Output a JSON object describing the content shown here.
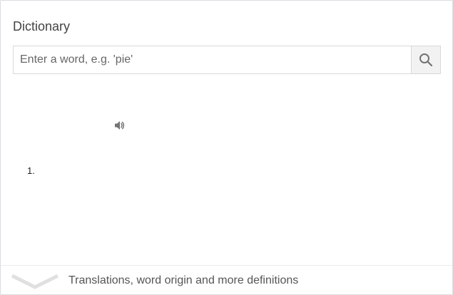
{
  "widget": {
    "title": "Dictionary"
  },
  "search": {
    "placeholder": "Enter a word, e.g. 'pie'",
    "value": "",
    "button_icon": "search-icon"
  },
  "entry": {
    "audio_icon": "speaker-icon",
    "definition_number": "1."
  },
  "footer": {
    "expand_icon": "chevron-down-icon",
    "label": "Translations, word origin and more definitions"
  },
  "colors": {
    "border": "#dadce0",
    "title_text": "#444444",
    "icon": "#737373",
    "chevron": "#e0e0e0",
    "footer_text": "#555555"
  }
}
